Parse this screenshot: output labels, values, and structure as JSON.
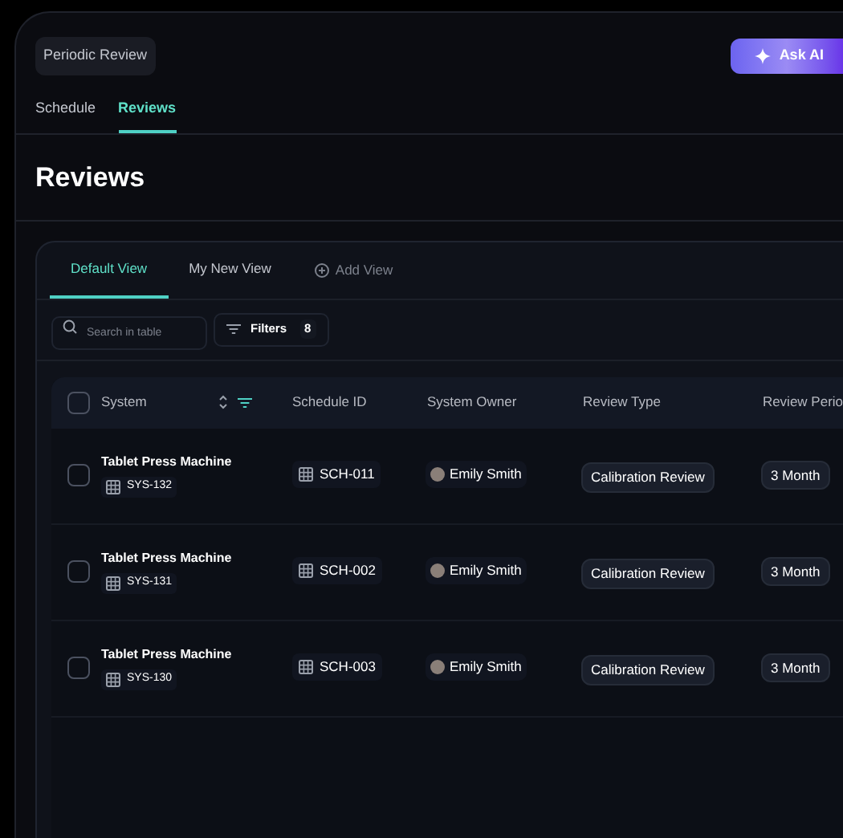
{
  "header": {
    "breadcrumb": "Periodic Review",
    "ask_button": "Ask AI"
  },
  "tabs": [
    {
      "label": "Schedule",
      "selected": false
    },
    {
      "label": "Reviews",
      "selected": true
    }
  ],
  "page_title": "Reviews",
  "view_tabs": [
    {
      "label": "Default View",
      "selected": true
    },
    {
      "label": "My New View",
      "selected": false
    }
  ],
  "add_view": "Add View",
  "search": {
    "placeholder": "Search in table"
  },
  "filters": {
    "label": "Filters",
    "count": "8"
  },
  "table": {
    "select_all_checked": false,
    "columns": [
      "System",
      "Schedule ID",
      "System Owner",
      "Review Type",
      "Review Perio"
    ],
    "rows": [
      {
        "checked": false,
        "system": "Tablet Press Machine",
        "system_id": "SYS-132",
        "schedule_id": "SCH-011",
        "owner": "Emily Smith",
        "review_type": "Calibration Review",
        "period": "3 Month"
      },
      {
        "checked": false,
        "system": "Tablet Press Machine",
        "system_id": "SYS-131",
        "schedule_id": "SCH-002",
        "owner": "Emily Smith",
        "review_type": "Calibration Review",
        "period": "3 Month"
      },
      {
        "checked": false,
        "system": "Tablet Press Machine",
        "system_id": "SYS-130",
        "schedule_id": "SCH-003",
        "owner": "Emily Smith",
        "review_type": "Calibration Review",
        "period": "3 Month"
      }
    ]
  }
}
